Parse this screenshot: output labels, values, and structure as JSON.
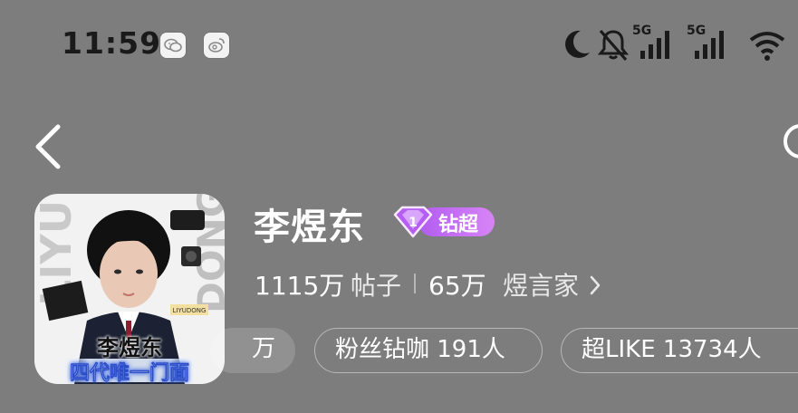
{
  "status_bar": {
    "time": "11:59",
    "app_icons": [
      "wechat-icon",
      "weibo-icon"
    ],
    "icons": [
      "moon-icon",
      "bell-muted-icon",
      "signal-5g-icon",
      "signal-5g-icon",
      "wifi-icon"
    ],
    "network_label_1": "5G",
    "network_label_2": "5G"
  },
  "nav": {
    "back_icon": "chevron-left-icon",
    "share_icon": "share-icon"
  },
  "avatar": {
    "caption_name": "李煜东",
    "caption_tag": "四代唯一门面"
  },
  "profile": {
    "name": "李煜东",
    "badge_label": "钻超",
    "badge_icon": "diamond-icon",
    "posts_value": "1115万",
    "posts_label": "帖子",
    "fans_value": "65万",
    "fans_label": "煜言家",
    "fans_arrow_icon": "chevron-right-icon"
  },
  "chips": {
    "partial_label": "万",
    "fans_diamond_label": "粉丝钻咖 191人",
    "super_like_label": "超LIKE 13734人"
  },
  "colors": {
    "background": "#7d7d7d",
    "badge_purple": "#c26df4",
    "text_primary": "#ffffff"
  }
}
